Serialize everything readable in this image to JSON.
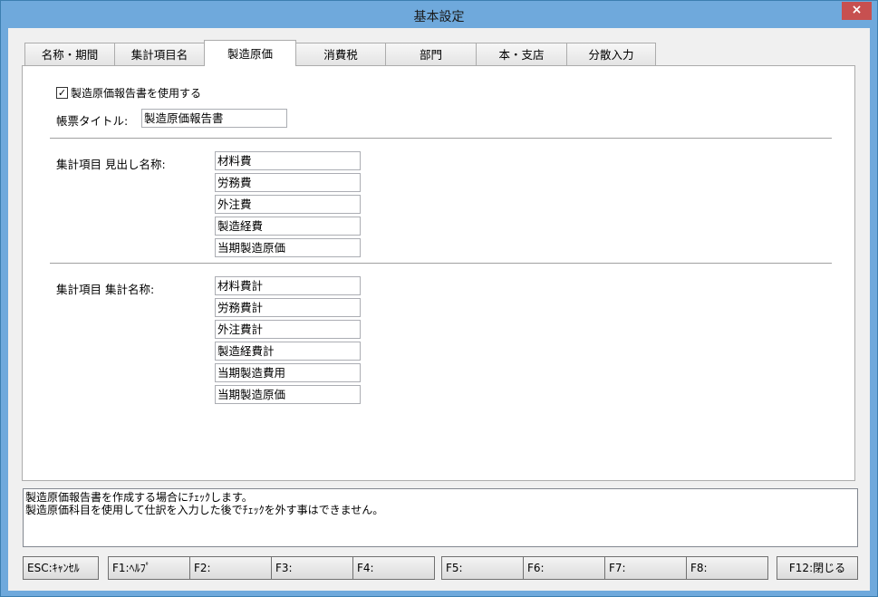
{
  "window": {
    "title": "基本設定",
    "close_label": "×"
  },
  "tabs": [
    {
      "label": "名称・期間"
    },
    {
      "label": "集計項目名"
    },
    {
      "label": "製造原価"
    },
    {
      "label": "消費税"
    },
    {
      "label": "部門"
    },
    {
      "label": "本・支店"
    },
    {
      "label": "分散入力"
    }
  ],
  "active_tab": "製造原価",
  "settings": {
    "use_report_label": "製造原価報告書を使用する",
    "use_report_checked": true,
    "check_mark": "✓",
    "report_title_label": "帳票タイトル:",
    "report_title_value": "製造原価報告書"
  },
  "heading_section": {
    "label": "集計項目  見出し名称:",
    "items": [
      "材料費",
      "労務費",
      "外注費",
      "製造経費",
      "当期製造原価"
    ]
  },
  "total_section": {
    "label": "集計項目  集計名称:",
    "items": [
      "材料費計",
      "労務費計",
      "外注費計",
      "製造経費計",
      "当期製造費用",
      "当期製造原価"
    ]
  },
  "message": {
    "line1": "製造原価報告書を作成する場合にﾁｪｯｸします。",
    "line2": "製造原価科目を使用して仕訳を入力した後でﾁｪｯｸを外す事はできません。"
  },
  "function_keys": [
    {
      "label": "ESC:ｷｬﾝｾﾙ"
    },
    {
      "label": "F1:ﾍﾙﾌﾟ"
    },
    {
      "label": "F2:"
    },
    {
      "label": "F3:"
    },
    {
      "label": "F4:"
    },
    {
      "label": "F5:"
    },
    {
      "label": "F6:"
    },
    {
      "label": "F7:"
    },
    {
      "label": "F8:"
    },
    {
      "label": "F12:閉じる"
    }
  ]
}
